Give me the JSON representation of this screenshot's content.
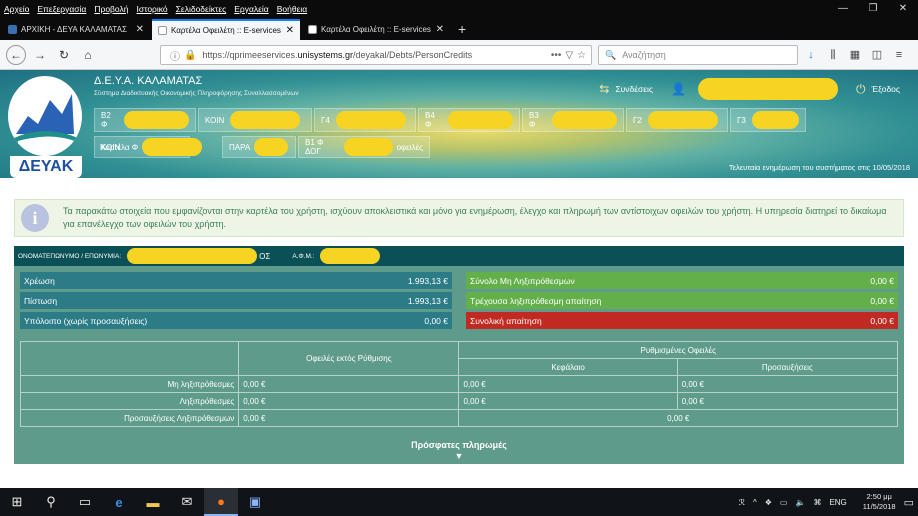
{
  "menubar": {
    "items": [
      "Αρχείο",
      "Επεξεργασία",
      "Προβολή",
      "Ιστορικό",
      "Σελιδοδείκτες",
      "Εργαλεία",
      "Βοήθεια"
    ]
  },
  "tabs": [
    {
      "title": "ΑΡΧΙΚΗ - ΔΕΥΑ ΚΑΛΑΜΑΤΑΣ"
    },
    {
      "title": "Καρτέλα Οφειλέτη :: E-services"
    },
    {
      "title": "Καρτέλα Οφειλέτη :: E-services"
    }
  ],
  "navbar": {
    "url_prefix": "https://qprimeeservices.",
    "url_domain": "unisystems.gr",
    "url_path": "/deyakal/Debts/PersonCredits",
    "search_placeholder": "Αναζήτηση"
  },
  "site": {
    "logo_text": "ΔΕΥΑΚ",
    "org_title": "Δ.Ε.Υ.Α. ΚΑΛΑΜΑΤΑΣ",
    "org_subtitle": "Σύστημα Διαδικτυακής Οικονομικής Πληροφόρησης Συναλλασσομένων",
    "connections_label": "Συνδέσεις",
    "logout_label": "Έξοδος",
    "last_update": "Τελευταία ενημέρωση του συστήματος στις 10/05/2018"
  },
  "account_tabs_row1": [
    "Β2 Φ",
    "ΚΟΙΝ",
    "Γ4",
    "Β4 Φ",
    "Β3 Φ",
    "Γ2",
    "Γ3"
  ],
  "account_tabs_row2": [
    "ΚΟΙΝ",
    "Καρτέλα Φ",
    "ΠΑΡΑ",
    "Β1 Φ ΔΟΓ",
    "οφειλές"
  ],
  "info": {
    "text": "Τα παρακάτω στοιχεία που εμφανίζονται στην καρτέλα του χρήστη, ισχύουν αποκλειστικά και μόνο για ενημέρωση, έλεγχο και πληρωμή των αντίστοιχων οφειλών του χρήστη. Η υπηρεσία διατηρεί το δικαίωμα για επανέλεγχο των οφειλών του χρήστη."
  },
  "debtor": {
    "name_label": "ΟΝΟΜΑΤΕΠΩΝΥΜΟ / ΕΠΩΝΥΜΙΑ:",
    "name_suffix": "ΟΣ",
    "afm_label": "Α.Φ.Μ.:"
  },
  "summary_left": [
    {
      "label": "Χρέωση",
      "value": "1.993,13 €"
    },
    {
      "label": "Πίστωση",
      "value": "1.993,13 €"
    },
    {
      "label": "Υπόλοιπο (χωρίς προσαυξήσεις)",
      "value": "0,00 €"
    }
  ],
  "summary_right": [
    {
      "label": "Σύνολο Μη Ληξιπρόθεσμων",
      "value": "0,00 €"
    },
    {
      "label": "Τρέχουσα ληξιπρόθεσμη απαίτηση",
      "value": "0,00 €"
    },
    {
      "label": "Συνολική απαίτηση",
      "value": "0,00 €"
    }
  ],
  "debts_table": {
    "col_outside": "Οφειλές εκτός Ρύθμισης",
    "col_regulated": "Ρυθμισμένες Οφειλές",
    "col_capital": "Κεφάλαιο",
    "col_surcharges": "Προσαυξήσεις",
    "rows": [
      {
        "label": "Μη ληξιπρόθεσμες",
        "outside": "0,00 €",
        "capital": "0,00 €",
        "surcharges": "0,00 €"
      },
      {
        "label": "Ληξιπρόθεσμες",
        "outside": "0,00 €",
        "capital": "0,00 €",
        "surcharges": "0,00 €"
      }
    ],
    "surcharge_row": {
      "label": "Προσαυξήσεις Ληξιπρόθεσμων",
      "outside": "0,00 €",
      "regulated": "0,00 €"
    }
  },
  "recent_payments": "Πρόσφατες πληρωμές",
  "taskbar": {
    "lang": "ENG",
    "time": "2:50 μμ",
    "date": "11/5/2018"
  }
}
